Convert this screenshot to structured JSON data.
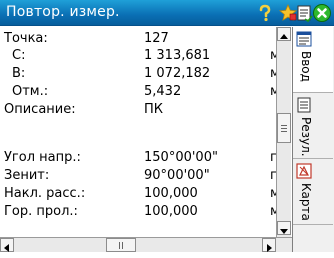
{
  "window": {
    "title": "Повтор. измер.",
    "icons": [
      "help-icon",
      "star-icon",
      "document-icon",
      "close-icon"
    ],
    "accent_color": "#0a6fb4"
  },
  "fields": [
    {
      "label": "Точка:",
      "value": "127",
      "unit": ""
    },
    {
      "label": "С:",
      "value": "1 313,681",
      "unit": "м"
    },
    {
      "label": "В:",
      "value": "1 072,182",
      "unit": "м"
    },
    {
      "label": "Отм.:",
      "value": "5,432",
      "unit": "м"
    },
    {
      "label": "Описание:",
      "value": "ПК",
      "unit": ""
    },
    {
      "label": "Угол напр.:",
      "value": "150°00'00\"",
      "unit": "гр"
    },
    {
      "label": "Зенит:",
      "value": "90°00'00\"",
      "unit": "гр"
    },
    {
      "label": "Накл. расс.:",
      "value": "100,000",
      "unit": "м"
    },
    {
      "label": "Гор. прол.:",
      "value": "100,000",
      "unit": "м"
    }
  ],
  "tabs": [
    {
      "label": "Ввод",
      "icon": "input-form-icon",
      "active": true
    },
    {
      "label": "Резул.",
      "icon": "results-icon",
      "active": false
    },
    {
      "label": "Карта",
      "icon": "map-icon",
      "active": false
    }
  ]
}
